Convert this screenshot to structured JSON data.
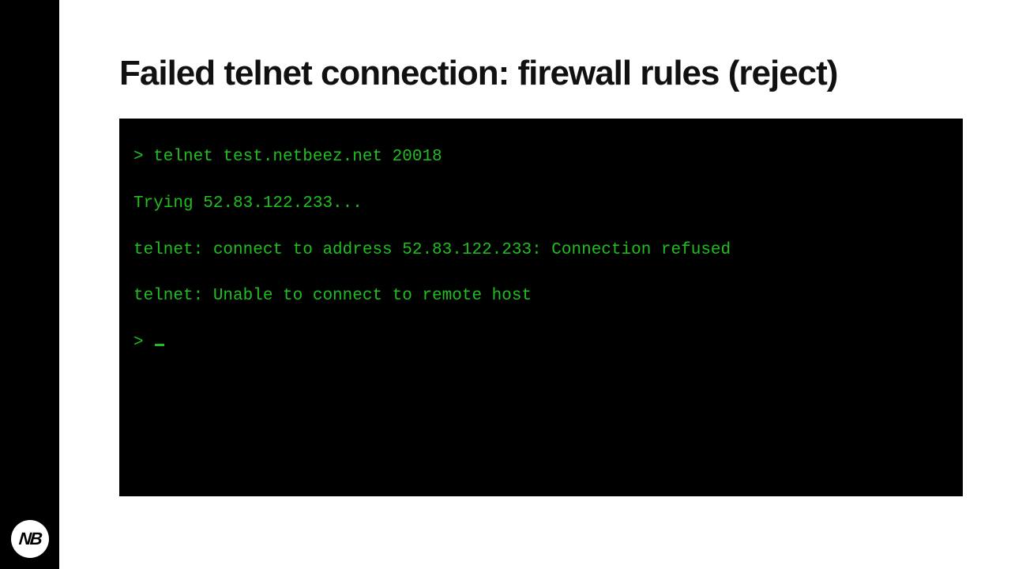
{
  "title": "Failed telnet connection: firewall rules (reject)",
  "logo_text": "NB",
  "terminal": {
    "line1": "> telnet test.netbeez.net 20018",
    "line2": "Trying 52.83.122.233...",
    "line3": "telnet: connect to address 52.83.122.233: Connection refused",
    "line4": "telnet: Unable to connect to remote host",
    "line5": "> "
  }
}
